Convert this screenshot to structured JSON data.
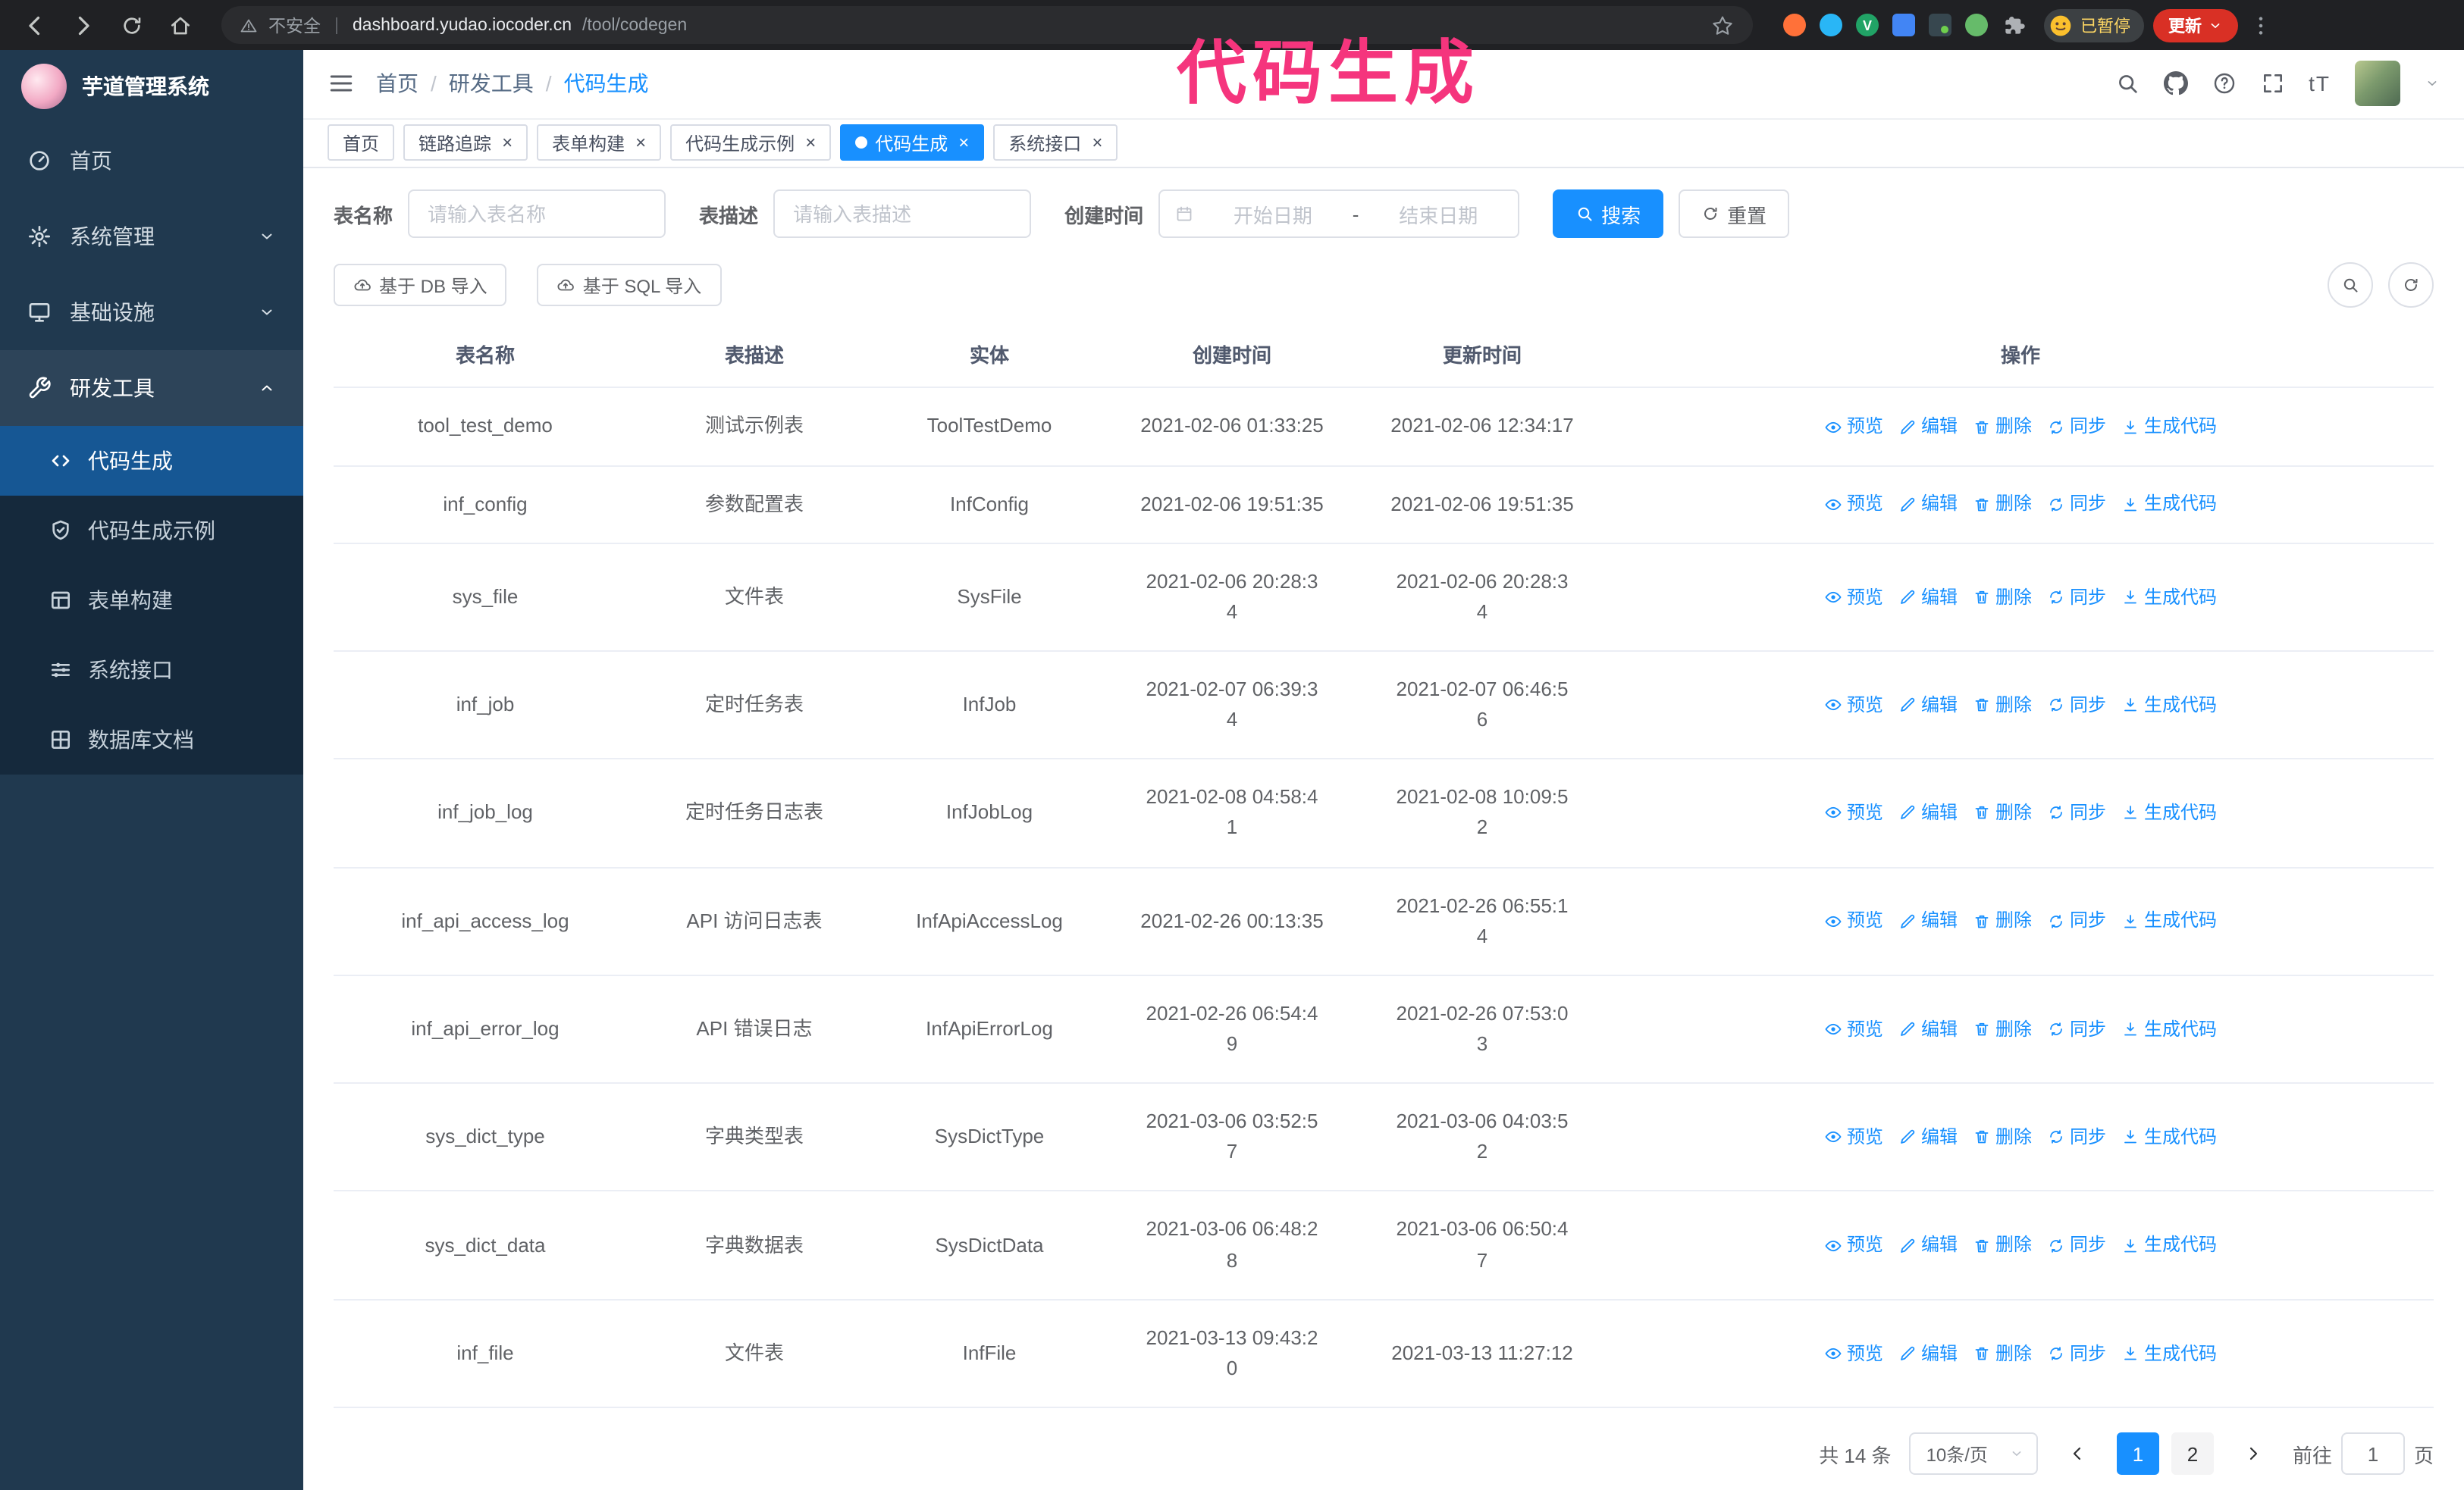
{
  "browser": {
    "security_warning": "不安全",
    "url_domain": "dashboard.yudao.iocoder.cn",
    "url_path": "/tool/codegen",
    "paused_badge": "已暂停",
    "update_button": "更新"
  },
  "annotation": {
    "text": "代码生成",
    "color": "#f5357d"
  },
  "sidebar": {
    "app_title": "芋道管理系统",
    "items": [
      {
        "id": "home",
        "label": "首页",
        "icon": "dashboard-icon",
        "chevron": null,
        "active": false
      },
      {
        "id": "system",
        "label": "系统管理",
        "icon": "gear-icon",
        "chevron": "down",
        "active": false
      },
      {
        "id": "infra",
        "label": "基础设施",
        "icon": "monitor-icon",
        "chevron": "down",
        "active": false
      },
      {
        "id": "devtools",
        "label": "研发工具",
        "icon": "tools-icon",
        "chevron": "up",
        "active": true
      }
    ],
    "sub_items": [
      {
        "id": "codegen",
        "label": "代码生成",
        "icon": "code-icon",
        "active": true
      },
      {
        "id": "codegen-example",
        "label": "代码生成示例",
        "icon": "example-icon",
        "active": false
      },
      {
        "id": "form-builder",
        "label": "表单构建",
        "icon": "form-icon",
        "active": false
      },
      {
        "id": "system-api",
        "label": "系统接口",
        "icon": "api-icon",
        "active": false
      },
      {
        "id": "db-doc",
        "label": "数据库文档",
        "icon": "database-icon",
        "active": false
      }
    ]
  },
  "header": {
    "breadcrumb": [
      "首页",
      "研发工具",
      "代码生成"
    ],
    "font_size_icon_text": "tT"
  },
  "tabs": [
    {
      "id": "home",
      "label": "首页",
      "closable": false,
      "active": false
    },
    {
      "id": "tracer",
      "label": "链路追踪",
      "closable": true,
      "active": false
    },
    {
      "id": "form-builder",
      "label": "表单构建",
      "closable": true,
      "active": false
    },
    {
      "id": "codegen-example",
      "label": "代码生成示例",
      "closable": true,
      "active": false
    },
    {
      "id": "codegen",
      "label": "代码生成",
      "closable": true,
      "active": true
    },
    {
      "id": "system-api",
      "label": "系统接口",
      "closable": true,
      "active": false
    }
  ],
  "filters": {
    "table_name_label": "表名称",
    "table_name_placeholder": "请输入表名称",
    "table_desc_label": "表描述",
    "table_desc_placeholder": "请输入表描述",
    "create_time_label": "创建时间",
    "date_start_placeholder": "开始日期",
    "date_separator": "-",
    "date_end_placeholder": "结束日期",
    "search_button": "搜索",
    "reset_button": "重置"
  },
  "toolbar": {
    "import_db_button": "基于 DB 导入",
    "import_sql_button": "基于 SQL 导入"
  },
  "table": {
    "columns": [
      "表名称",
      "表描述",
      "实体",
      "创建时间",
      "更新时间",
      "操作"
    ],
    "operations": [
      {
        "key": "preview",
        "label": "预览",
        "icon": "eye-icon"
      },
      {
        "key": "edit",
        "label": "编辑",
        "icon": "edit-icon"
      },
      {
        "key": "delete",
        "label": "删除",
        "icon": "delete-icon"
      },
      {
        "key": "sync",
        "label": "同步",
        "icon": "sync-icon"
      },
      {
        "key": "generate-code",
        "label": "生成代码",
        "icon": "download-icon"
      }
    ],
    "rows": [
      {
        "name": "tool_test_demo",
        "description": "测试示例表",
        "entity": "ToolTestDemo",
        "create_time": "2021-02-06 01:33:25",
        "update_time": "2021-02-06 12:34:17"
      },
      {
        "name": "inf_config",
        "description": "参数配置表",
        "entity": "InfConfig",
        "create_time": "2021-02-06 19:51:35",
        "update_time": "2021-02-06 19:51:35"
      },
      {
        "name": "sys_file",
        "description": "文件表",
        "entity": "SysFile",
        "create_time": "2021-02-06 20:28:3\n4",
        "update_time": "2021-02-06 20:28:3\n4"
      },
      {
        "name": "inf_job",
        "description": "定时任务表",
        "entity": "InfJob",
        "create_time": "2021-02-07 06:39:3\n4",
        "update_time": "2021-02-07 06:46:5\n6"
      },
      {
        "name": "inf_job_log",
        "description": "定时任务日志表",
        "entity": "InfJobLog",
        "create_time": "2021-02-08 04:58:4\n1",
        "update_time": "2021-02-08 10:09:5\n2"
      },
      {
        "name": "inf_api_access_log",
        "description": "API 访问日志表",
        "entity": "InfApiAccessLog",
        "create_time": "2021-02-26 00:13:35",
        "update_time": "2021-02-26 06:55:1\n4"
      },
      {
        "name": "inf_api_error_log",
        "description": "API 错误日志",
        "entity": "InfApiErrorLog",
        "create_time": "2021-02-26 06:54:4\n9",
        "update_time": "2021-02-26 07:53:0\n3"
      },
      {
        "name": "sys_dict_type",
        "description": "字典类型表",
        "entity": "SysDictType",
        "create_time": "2021-03-06 03:52:5\n7",
        "update_time": "2021-03-06 04:03:5\n2"
      },
      {
        "name": "sys_dict_data",
        "description": "字典数据表",
        "entity": "SysDictData",
        "create_time": "2021-03-06 06:48:2\n8",
        "update_time": "2021-03-06 06:50:4\n7"
      },
      {
        "name": "inf_file",
        "description": "文件表",
        "entity": "InfFile",
        "create_time": "2021-03-13 09:43:2\n0",
        "update_time": "2021-03-13 11:27:12"
      }
    ]
  },
  "pagination": {
    "total_text": "共 14 条",
    "page_size_text": "10条/页",
    "pages": [
      "1",
      "2"
    ],
    "active_page": "1",
    "goto_label": "前往",
    "goto_value": "1",
    "goto_unit": "页"
  },
  "colors": {
    "accent": "#1890ff",
    "sidebar_bg": "#20394f",
    "submenu_bg": "#15293c",
    "update_button_bg": "#d93025"
  }
}
